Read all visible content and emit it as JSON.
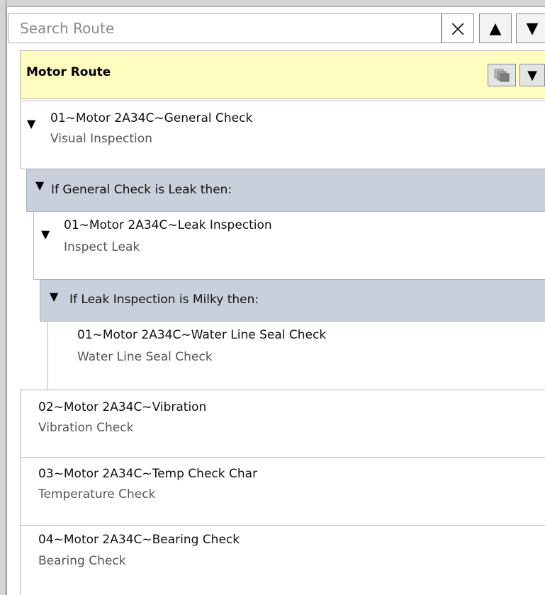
{
  "search": {
    "placeholder": "Search Route",
    "clear_icon": "×",
    "up_icon": "▲",
    "down_icon": "▼"
  },
  "route": {
    "title": "Motor Route",
    "menu_icon": "▼"
  },
  "steps": [
    {
      "title": "01~Motor 2A34C~General Check",
      "subtitle": "Visual Inspection",
      "toggle": "▼"
    },
    {
      "condition": "If General Check is Leak then:",
      "toggle": "▼"
    },
    {
      "title": "01~Motor 2A34C~Leak Inspection",
      "subtitle": "Inspect Leak",
      "toggle": "▼"
    },
    {
      "condition": "If Leak Inspection is Milky then:",
      "toggle": "▼"
    },
    {
      "title": "01~Motor 2A34C~Water Line Seal Check",
      "subtitle": "Water Line Seal Check"
    },
    {
      "title": "02~Motor 2A34C~Vibration",
      "subtitle": "Vibration Check"
    },
    {
      "title": "03~Motor 2A34C~Temp Check Char",
      "subtitle": "Temperature Check"
    },
    {
      "title": "04~Motor 2A34C~Bearing Check",
      "subtitle": "Bearing Check"
    }
  ],
  "colors": {
    "route_header_bg": "#fffcc0",
    "condition_bg": "#c9d0db"
  }
}
